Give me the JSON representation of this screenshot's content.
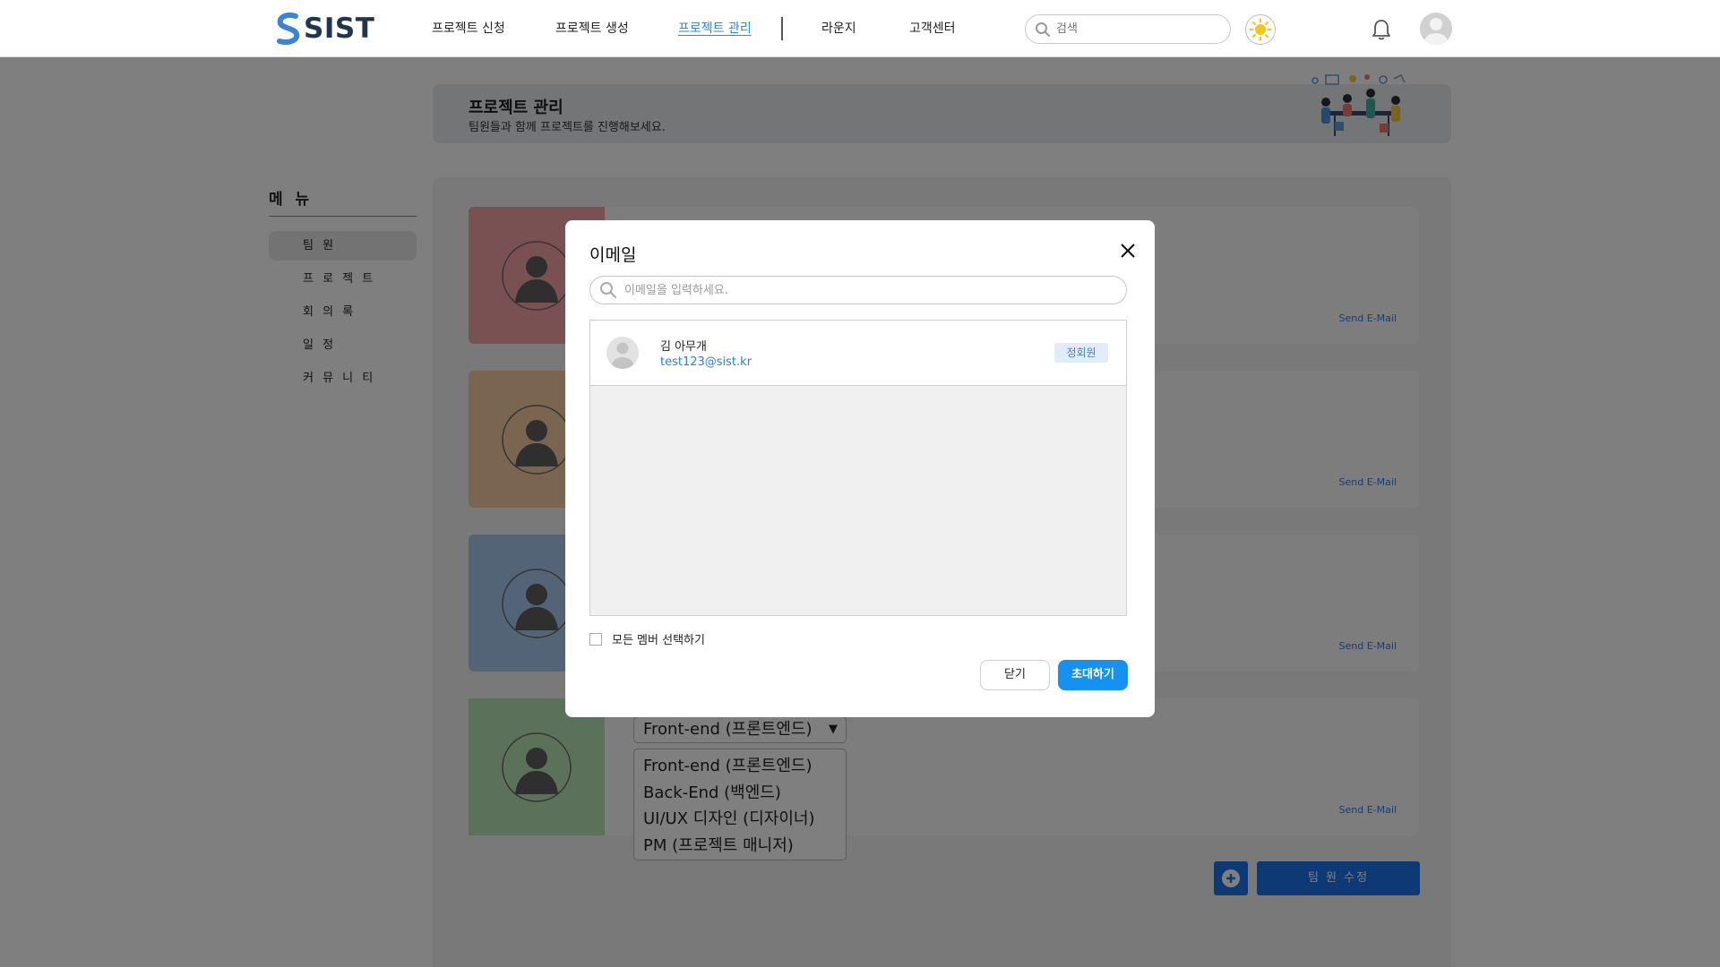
{
  "brand": {
    "name": "SIST"
  },
  "nav": {
    "items": [
      {
        "label": "프로젝트 신청"
      },
      {
        "label": "프로젝트 생성"
      },
      {
        "label": "프로젝트 관리"
      },
      {
        "label": "라운지"
      },
      {
        "label": "고객센터"
      }
    ],
    "active_index": 2
  },
  "search": {
    "placeholder": "검색"
  },
  "header": {
    "title": "프로젝트 관리",
    "subtitle": "팀원들과 함께 프로젝트를 진행해보세요."
  },
  "sidebar": {
    "title": "메 뉴",
    "items": [
      {
        "label": "팀 원"
      },
      {
        "label": "프 로 젝 트"
      },
      {
        "label": "회 의 록"
      },
      {
        "label": "일 정"
      },
      {
        "label": "커 뮤 니 티"
      }
    ],
    "active_index": 0
  },
  "members": {
    "send_label": "Send E-Mail",
    "card_colors": [
      "#f4a3a5",
      "#f2caa1",
      "#a7c9ef",
      "#b8e2b3"
    ],
    "role_selected": "Front-end (프론트엔드)",
    "role_options": [
      "Front-end (프론트엔드)",
      "Back-End (백엔드)",
      "UI/UX 디자인 (디자이너)",
      "PM (프로젝트 매니저)"
    ],
    "edit_label": "팀 원 수정"
  },
  "modal": {
    "title": "이메일",
    "search_placeholder": "이메일을 입력하세요.",
    "results": [
      {
        "name": "김 아무개",
        "email": "test123@sist.kr",
        "badge": "정회원"
      }
    ],
    "select_all_label": "모든 멤버 선택하기",
    "close_label": "닫기",
    "invite_label": "초대하기"
  },
  "colors": {
    "accent": "#1a8cff",
    "primary_button": "#1592f0",
    "edit_button": "#1a73e8",
    "link": "#2b7de9"
  }
}
